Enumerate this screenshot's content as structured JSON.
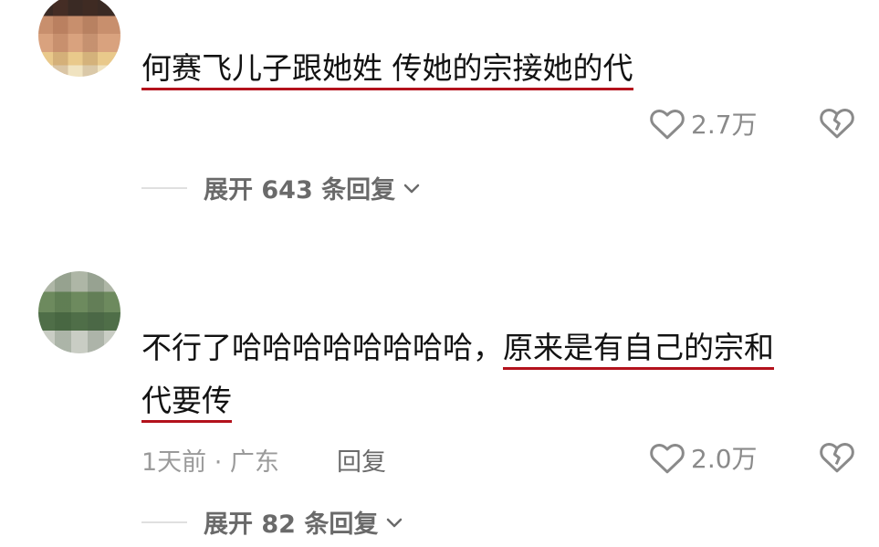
{
  "comments": [
    {
      "text_plain": "",
      "text_underlined": "何赛飞儿子跟她姓 传她的宗接她的代",
      "likes": "2.7万",
      "expand_label": "展开 643 条回复"
    },
    {
      "text_plain": "不行了哈哈哈哈哈哈哈哈，",
      "text_underlined": "原来是有自己的宗和",
      "text_line2_underlined": "代要传",
      "time_location": "1天前 · 广东",
      "reply_label": "回复",
      "likes": "2.0万",
      "expand_label": "展开 82 条回复"
    }
  ],
  "icons": {
    "like": "heart-outline-icon",
    "dislike": "broken-heart-icon",
    "expand": "chevron-down-icon"
  },
  "colors": {
    "underline": "#b3121c",
    "text": "#121212",
    "muted": "#9a9a9a"
  }
}
